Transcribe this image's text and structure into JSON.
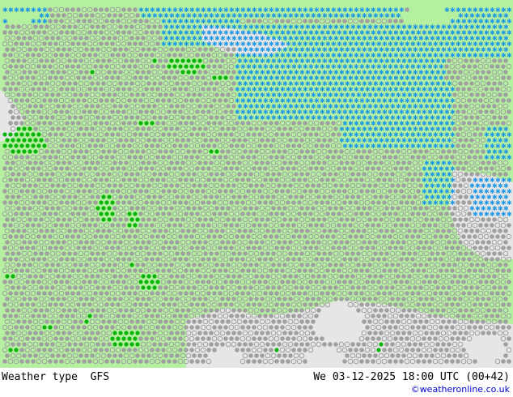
{
  "footer": {
    "product_label": "Weather type",
    "model_label": "GFS",
    "valid_time": "We 03-12-2025 18:00 UTC (00+42)",
    "credit": "©weatheronline.co.uk"
  },
  "map": {
    "colors": {
      "land": "#b4f0a0",
      "sea": "#e6e6e6",
      "cloud_symbol": "#a0a0a0",
      "snow_symbol": "#1e96e6",
      "rain_symbol": "#0ab40a"
    },
    "symbol_types": [
      "cloudy",
      "overcast",
      "snow",
      "rain",
      "showers"
    ]
  }
}
